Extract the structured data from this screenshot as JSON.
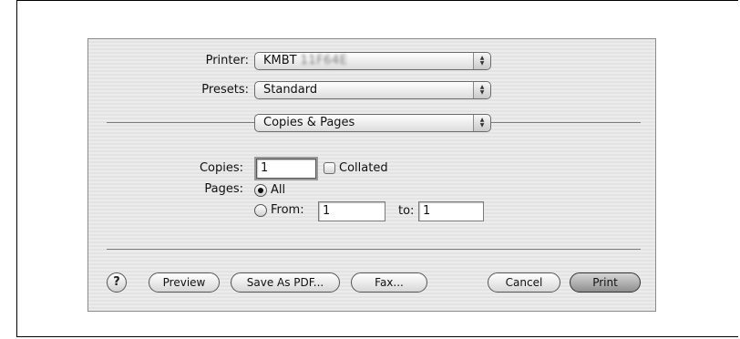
{
  "printer": {
    "label": "Printer:",
    "value": "KMBT",
    "value_obscured": "11F64E"
  },
  "presets": {
    "label": "Presets:",
    "value": "Standard"
  },
  "panel_select": {
    "value": "Copies & Pages"
  },
  "copies": {
    "label": "Copies:",
    "value": "1",
    "collated_label": "Collated",
    "collated_checked": false
  },
  "pages": {
    "label": "Pages:",
    "all_label": "All",
    "all_selected": true,
    "from_label": "From:",
    "from_value": "1",
    "to_label": "to:",
    "to_value": "1"
  },
  "buttons": {
    "help": "?",
    "preview": "Preview",
    "save_pdf": "Save As PDF...",
    "fax": "Fax...",
    "cancel": "Cancel",
    "print": "Print"
  }
}
